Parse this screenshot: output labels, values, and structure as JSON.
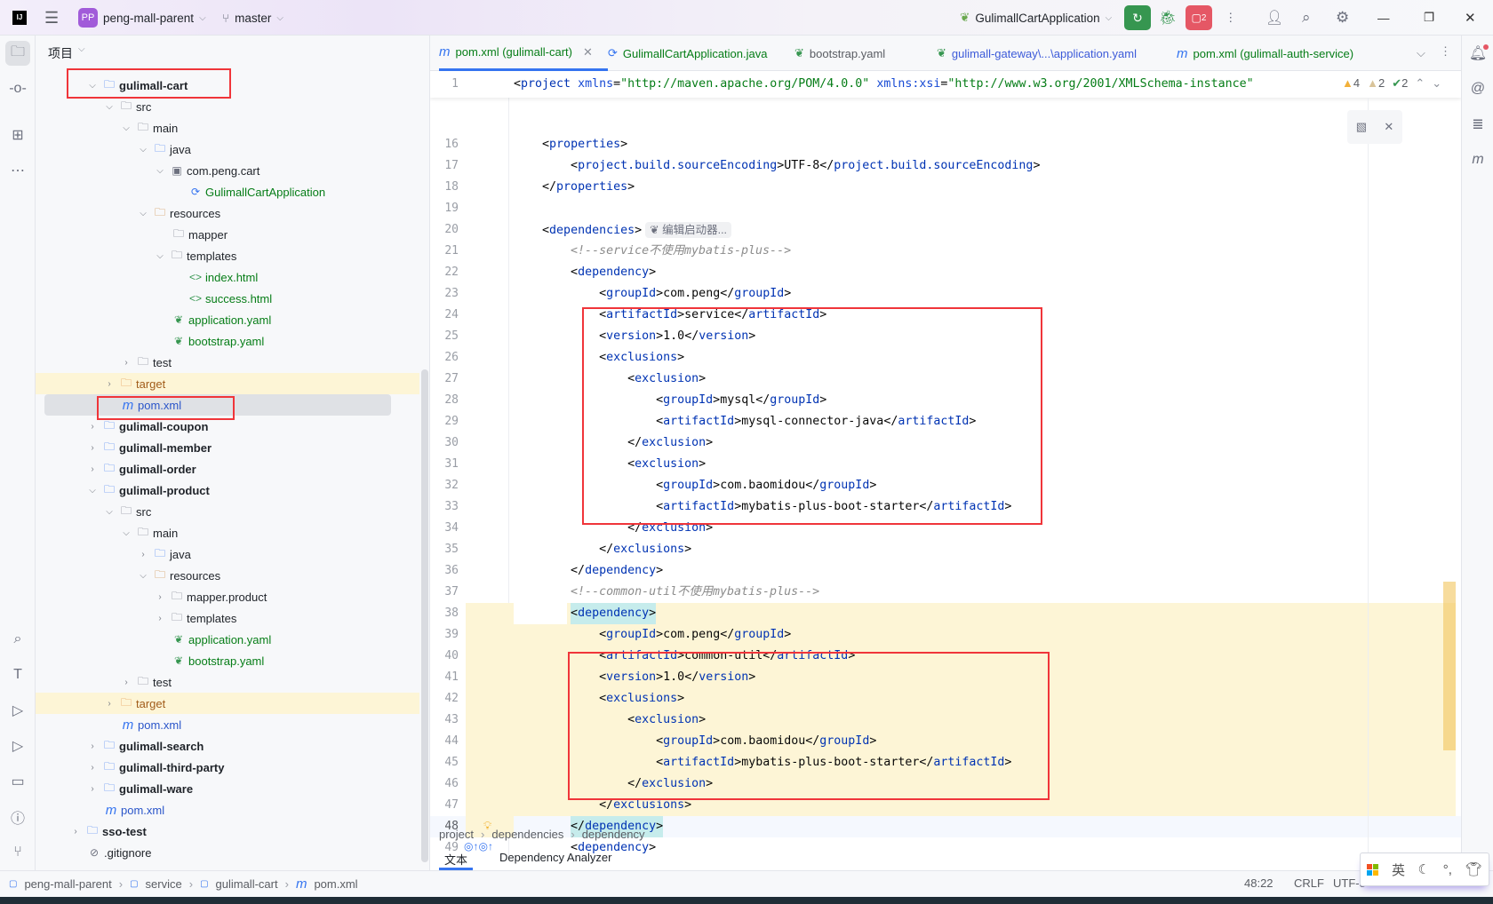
{
  "titlebar": {
    "project_initials": "PP",
    "project_name": "peng-mall-parent",
    "branch": "master",
    "run_config": "GulimallCartApplication",
    "run_badge": "2"
  },
  "colors": {
    "accent": "#3574f0",
    "run_green": "#369650",
    "stop_red": "#e55765",
    "highlight_red": "#f0353a",
    "selection_yellow": "#fdf5d6"
  },
  "project_panel": {
    "title": "项目",
    "tree": [
      {
        "label": "gulimall-cart",
        "level": 1,
        "kind": "module",
        "state": "open",
        "bold": true
      },
      {
        "label": "src",
        "level": 2,
        "kind": "folder",
        "state": "open"
      },
      {
        "label": "main",
        "level": 3,
        "kind": "folder",
        "state": "open"
      },
      {
        "label": "java",
        "level": 4,
        "kind": "srcfolder",
        "state": "open"
      },
      {
        "label": "com.peng.cart",
        "level": 5,
        "kind": "package",
        "state": "open"
      },
      {
        "label": "GulimallCartApplication",
        "level": 6,
        "kind": "spring",
        "state": "leaf",
        "color": "green"
      },
      {
        "label": "resources",
        "level": 4,
        "kind": "resfolder",
        "state": "open"
      },
      {
        "label": "mapper",
        "level": 5,
        "kind": "folder",
        "state": "leaf"
      },
      {
        "label": "templates",
        "level": 5,
        "kind": "folder",
        "state": "open"
      },
      {
        "label": "index.html",
        "level": 6,
        "kind": "html",
        "state": "leaf",
        "color": "green"
      },
      {
        "label": "success.html",
        "level": 6,
        "kind": "html",
        "state": "leaf",
        "color": "green"
      },
      {
        "label": "application.yaml",
        "level": 5,
        "kind": "yaml",
        "state": "leaf",
        "color": "green"
      },
      {
        "label": "bootstrap.yaml",
        "level": 5,
        "kind": "yaml",
        "state": "leaf",
        "color": "green"
      },
      {
        "label": "test",
        "level": 3,
        "kind": "folder",
        "state": "closed"
      },
      {
        "label": "target",
        "level": 2,
        "kind": "excluded",
        "state": "closed",
        "bg": "yellow"
      },
      {
        "label": "pom.xml",
        "level": 2,
        "kind": "maven",
        "state": "leaf",
        "color": "blue",
        "selected": true
      },
      {
        "label": "gulimall-coupon",
        "level": 1,
        "kind": "module",
        "state": "closed",
        "bold": true
      },
      {
        "label": "gulimall-member",
        "level": 1,
        "kind": "module",
        "state": "closed",
        "bold": true
      },
      {
        "label": "gulimall-order",
        "level": 1,
        "kind": "module",
        "state": "closed",
        "bold": true
      },
      {
        "label": "gulimall-product",
        "level": 1,
        "kind": "module",
        "state": "open",
        "bold": true
      },
      {
        "label": "src",
        "level": 2,
        "kind": "folder",
        "state": "open"
      },
      {
        "label": "main",
        "level": 3,
        "kind": "folder",
        "state": "open"
      },
      {
        "label": "java",
        "level": 4,
        "kind": "srcfolder",
        "state": "closed"
      },
      {
        "label": "resources",
        "level": 4,
        "kind": "resfolder",
        "state": "open"
      },
      {
        "label": "mapper.product",
        "level": 5,
        "kind": "folder",
        "state": "closed"
      },
      {
        "label": "templates",
        "level": 5,
        "kind": "folder",
        "state": "closed"
      },
      {
        "label": "application.yaml",
        "level": 5,
        "kind": "yaml",
        "state": "leaf",
        "color": "green"
      },
      {
        "label": "bootstrap.yaml",
        "level": 5,
        "kind": "yaml",
        "state": "leaf",
        "color": "green"
      },
      {
        "label": "test",
        "level": 3,
        "kind": "folder",
        "state": "closed"
      },
      {
        "label": "target",
        "level": 2,
        "kind": "excluded",
        "state": "closed",
        "bg": "yellow"
      },
      {
        "label": "pom.xml",
        "level": 2,
        "kind": "maven",
        "state": "leaf",
        "color": "blue"
      },
      {
        "label": "gulimall-search",
        "level": 1,
        "kind": "module",
        "state": "closed",
        "bold": true
      },
      {
        "label": "gulimall-third-party",
        "level": 1,
        "kind": "module",
        "state": "closed",
        "bold": true
      },
      {
        "label": "gulimall-ware",
        "level": 1,
        "kind": "module",
        "state": "closed",
        "bold": true
      },
      {
        "label": "pom.xml",
        "level": 1,
        "kind": "maven",
        "state": "leaf",
        "color": "blue"
      },
      {
        "label": "sso-test",
        "level": 0,
        "kind": "module",
        "state": "closed",
        "bold": true
      },
      {
        "label": ".gitignore",
        "level": 0,
        "kind": "ignore",
        "state": "leaf"
      }
    ]
  },
  "editor": {
    "tabs": [
      {
        "label": "pom.xml (gulimall-cart)",
        "icon": "maven",
        "active": true,
        "color": "#067d17"
      },
      {
        "label": "GulimallCartApplication.java",
        "icon": "spring",
        "color": "#067d17"
      },
      {
        "label": "bootstrap.yaml",
        "icon": "yaml",
        "color": "#5a5d63"
      },
      {
        "label": "gulimall-gateway\\...\\application.yaml",
        "icon": "yaml",
        "color": "#3d5bd9"
      },
      {
        "label": "pom.xml (gulimall-auth-service)",
        "icon": "maven",
        "color": "#067d17"
      }
    ],
    "inspections": {
      "warnings": "4",
      "weak_warnings": "2",
      "typos": "2"
    },
    "sticky_line": {
      "n": 1,
      "text": "<project xmlns=\"http://maven.apache.org/POM/4.0.0\" xmlns:xsi=\"http://www.w3.org/2001/XMLSchema-instance\""
    },
    "inlay_hint": "编辑启动器...",
    "current_line": 48,
    "lines": [
      {
        "n": 16,
        "text": "    <properties>"
      },
      {
        "n": 17,
        "text": "        <project.build.sourceEncoding>UTF-8</project.build.sourceEncoding>"
      },
      {
        "n": 18,
        "text": "    </properties>"
      },
      {
        "n": 19,
        "text": ""
      },
      {
        "n": 20,
        "text": "    <dependencies>"
      },
      {
        "n": 21,
        "text": "        <!--service不使用mybatis-plus-->"
      },
      {
        "n": 22,
        "text": "        <dependency>"
      },
      {
        "n": 23,
        "text": "            <groupId>com.peng</groupId>"
      },
      {
        "n": 24,
        "text": "            <artifactId>service</artifactId>"
      },
      {
        "n": 25,
        "text": "            <version>1.0</version>"
      },
      {
        "n": 26,
        "text": "            <exclusions>"
      },
      {
        "n": 27,
        "text": "                <exclusion>"
      },
      {
        "n": 28,
        "text": "                    <groupId>mysql</groupId>"
      },
      {
        "n": 29,
        "text": "                    <artifactId>mysql-connector-java</artifactId>"
      },
      {
        "n": 30,
        "text": "                </exclusion>"
      },
      {
        "n": 31,
        "text": "                <exclusion>"
      },
      {
        "n": 32,
        "text": "                    <groupId>com.baomidou</groupId>"
      },
      {
        "n": 33,
        "text": "                    <artifactId>mybatis-plus-boot-starter</artifactId>"
      },
      {
        "n": 34,
        "text": "                </exclusion>"
      },
      {
        "n": 35,
        "text": "            </exclusions>"
      },
      {
        "n": 36,
        "text": "        </dependency>"
      },
      {
        "n": 37,
        "text": "        <!--common-util不使用mybatis-plus-->"
      },
      {
        "n": 38,
        "text": "        <dependency>"
      },
      {
        "n": 39,
        "text": "            <groupId>com.peng</groupId>"
      },
      {
        "n": 40,
        "text": "            <artifactId>common-util</artifactId>"
      },
      {
        "n": 41,
        "text": "            <version>1.0</version>"
      },
      {
        "n": 42,
        "text": "            <exclusions>"
      },
      {
        "n": 43,
        "text": "                <exclusion>"
      },
      {
        "n": 44,
        "text": "                    <groupId>com.baomidou</groupId>"
      },
      {
        "n": 45,
        "text": "                    <artifactId>mybatis-plus-boot-starter</artifactId>"
      },
      {
        "n": 46,
        "text": "                </exclusion>"
      },
      {
        "n": 47,
        "text": "            </exclusions>"
      },
      {
        "n": 48,
        "text": "        </dependency>"
      },
      {
        "n": 49,
        "text": "        <dependency>"
      }
    ],
    "breadcrumb": [
      "project",
      "dependencies",
      "dependency"
    ],
    "bottom_tabs": [
      {
        "label": "文本",
        "active": true
      },
      {
        "label": "Dependency Analyzer"
      }
    ]
  },
  "statusbar": {
    "path": [
      "peng-mall-parent",
      "service",
      "gulimall-cart",
      "pom.xml"
    ],
    "position": "48:22",
    "line_sep": "CRLF",
    "encoding": "UTF-8"
  },
  "ime": {
    "lang": "英"
  }
}
